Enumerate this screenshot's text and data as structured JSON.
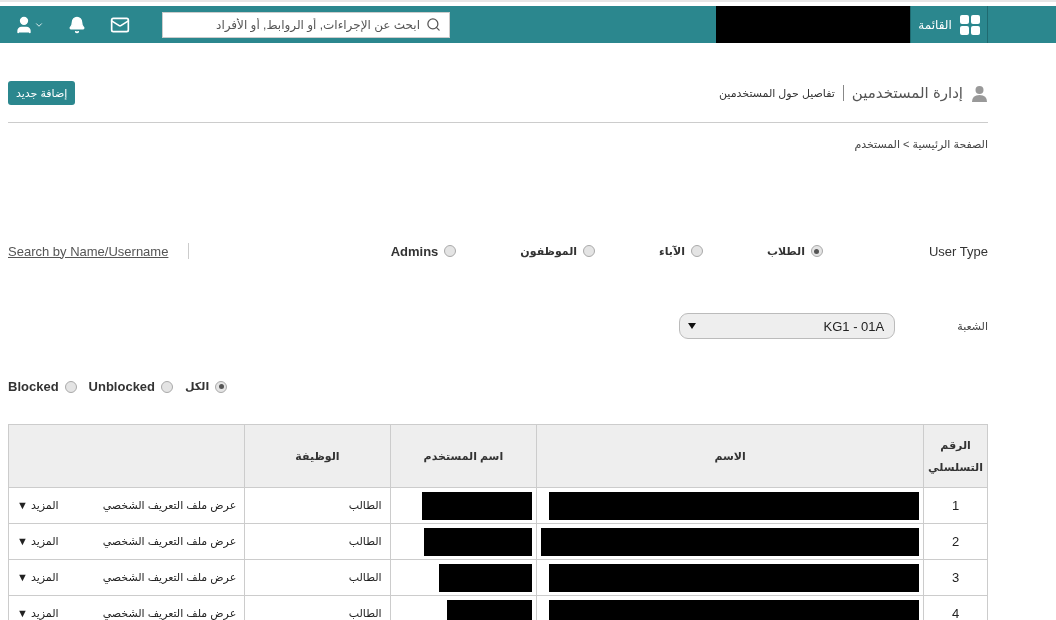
{
  "topbar": {
    "menu_label": "القائمة",
    "search": {
      "placeholder": "ابحث عن الإجراءات, أو الروابط, أو الأفراد"
    }
  },
  "header": {
    "title": "إدارة المستخدمين",
    "subtitle": "تفاصيل حول المستخدمين",
    "add_button": "إضافة جديد"
  },
  "breadcrumb": "الصفحة الرئيسية > المستخدم",
  "user_type": {
    "label": "User Type",
    "options": [
      {
        "label": "الطلاب",
        "selected": true
      },
      {
        "label": "الآباء",
        "selected": false
      },
      {
        "label": "الموظفون",
        "selected": false
      },
      {
        "label": "Admins",
        "selected": false
      }
    ]
  },
  "search_link": "Search by Name/Username",
  "section": {
    "label": "الشعبة",
    "value": "KG1 - 01A"
  },
  "status_filter": {
    "options": [
      {
        "label": "الكل",
        "selected": true
      },
      {
        "label": "Unblocked",
        "selected": false
      },
      {
        "label": "Blocked",
        "selected": false
      }
    ]
  },
  "table": {
    "columns": [
      "الرقم التسلسلي",
      "الاسم",
      "اسم المستخدم",
      "الوظيفة"
    ],
    "rows": [
      {
        "serial": "1",
        "role": "الطالب",
        "profile_link": "عرض ملف التعريف الشخصي",
        "more": "المزيد ▼"
      },
      {
        "serial": "2",
        "role": "الطالب",
        "profile_link": "عرض ملف التعريف الشخصي",
        "more": "المزيد ▼"
      },
      {
        "serial": "3",
        "role": "الطالب",
        "profile_link": "عرض ملف التعريف الشخصي",
        "more": "المزيد ▼"
      },
      {
        "serial": "4",
        "role": "الطالب",
        "profile_link": "عرض ملف التعريف الشخصي",
        "more": "المزيد ▼"
      }
    ]
  }
}
